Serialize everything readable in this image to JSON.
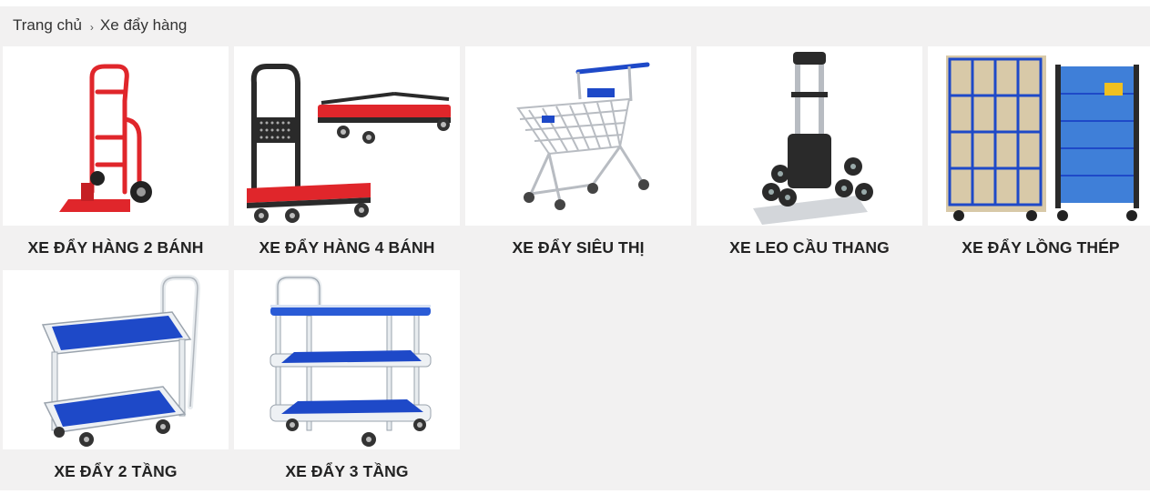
{
  "breadcrumb": {
    "home": "Trang chủ",
    "separator": "›",
    "current": "Xe đẩy hàng"
  },
  "products": [
    {
      "title": "XE ĐẨY HÀNG 2 BÁNH",
      "icon": "hand-truck-2-wheel-icon"
    },
    {
      "title": "XE ĐẨY HÀNG 4 BÁNH",
      "icon": "platform-trolley-4-wheel-icon"
    },
    {
      "title": "XE ĐẨY SIÊU THỊ",
      "icon": "shopping-cart-icon"
    },
    {
      "title": "XE LEO CẦU THANG",
      "icon": "stair-climbing-trolley-icon"
    },
    {
      "title": "XE ĐẨY LỒNG THÉP",
      "icon": "steel-cage-trolley-icon"
    },
    {
      "title": "XE ĐẨY 2 TẦNG",
      "icon": "two-tier-trolley-icon"
    },
    {
      "title": "XE ĐẨY 3 TẦNG",
      "icon": "three-tier-trolley-icon"
    }
  ],
  "colors": {
    "background": "#f2f1f1",
    "card": "#ffffff",
    "red": "#e0262b",
    "blue": "#1e49c8",
    "steel": "#b8bcc2"
  }
}
